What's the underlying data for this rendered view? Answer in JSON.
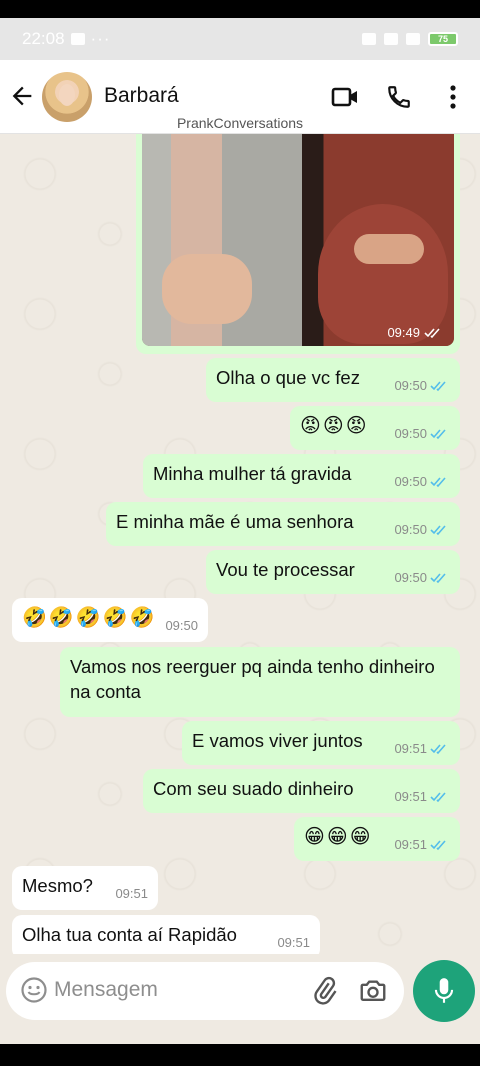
{
  "status_bar": {
    "time": "22:08",
    "extra": "···",
    "battery": "75"
  },
  "header": {
    "contact_name": "Barbará",
    "watermark": "PrankConversations"
  },
  "messages": [
    {
      "time": "09:49"
    },
    {
      "text": "Olha o que vc fez",
      "time": "09:50"
    },
    {
      "text": "😡😡😡",
      "time": "09:50"
    },
    {
      "text": "Minha mulher tá gravida",
      "time": "09:50"
    },
    {
      "text": "E minha mãe é uma senhora",
      "time": "09:50"
    },
    {
      "text": "Vou te processar",
      "time": "09:50"
    },
    {
      "text": "🤣🤣🤣🤣🤣",
      "time": "09:50"
    },
    {
      "text": "Vamos nos reerguer pq ainda tenho dinheiro na conta"
    },
    {
      "text": "E vamos viver juntos",
      "time": "09:51"
    },
    {
      "text": "Com seu suado dinheiro",
      "time": "09:51"
    },
    {
      "text": "😁😁😁",
      "time": "09:51"
    },
    {
      "text": "Mesmo?",
      "time": "09:51"
    },
    {
      "text": "Olha tua conta aí Rapidão",
      "time": "09:51"
    }
  ],
  "composer": {
    "placeholder": "Mensagem"
  },
  "colors": {
    "outgoing": "#d9fdd3",
    "incoming": "#ffffff",
    "accent": "#1ea37a",
    "read_ticks": "#53bdeb"
  },
  "icons": [
    "back-arrow-icon",
    "video-call-icon",
    "phone-icon",
    "more-vert-icon",
    "emoji-icon",
    "attach-icon",
    "camera-icon",
    "mic-icon",
    "double-check-icon"
  ]
}
